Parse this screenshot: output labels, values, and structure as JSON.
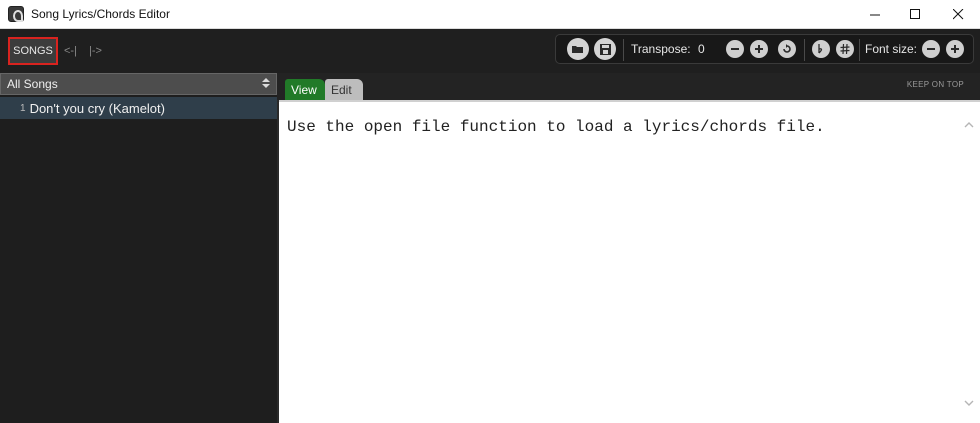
{
  "window": {
    "title": "Song Lyrics/Chords Editor"
  },
  "toolbar": {
    "songs_label": "SONGS",
    "prev_label": "<-|",
    "next_label": "|->",
    "transpose_label": "Transpose:",
    "transpose_value": "0",
    "font_size_label": "Font size:",
    "icons": [
      "open-folder-icon",
      "save-icon",
      "minus-icon",
      "plus-icon",
      "reset-icon",
      "flat-icon",
      "sharp-icon",
      "font-minus-icon",
      "font-plus-icon"
    ]
  },
  "sidebar": {
    "filter_selected": "All Songs",
    "songs": [
      {
        "number": "1",
        "title": "Don't you cry (Kamelot)"
      }
    ]
  },
  "tabs": [
    {
      "label": "View",
      "active": true
    },
    {
      "label": "Edit",
      "active": false
    }
  ],
  "keep_on_top_label": "KEEP ON TOP",
  "editor": {
    "content": "Use the open file function to load a lyrics/chords file."
  },
  "colors": {
    "highlight_border": "#d9231f",
    "active_tab": "#217a28",
    "selected_row": "#2f3e4a"
  }
}
